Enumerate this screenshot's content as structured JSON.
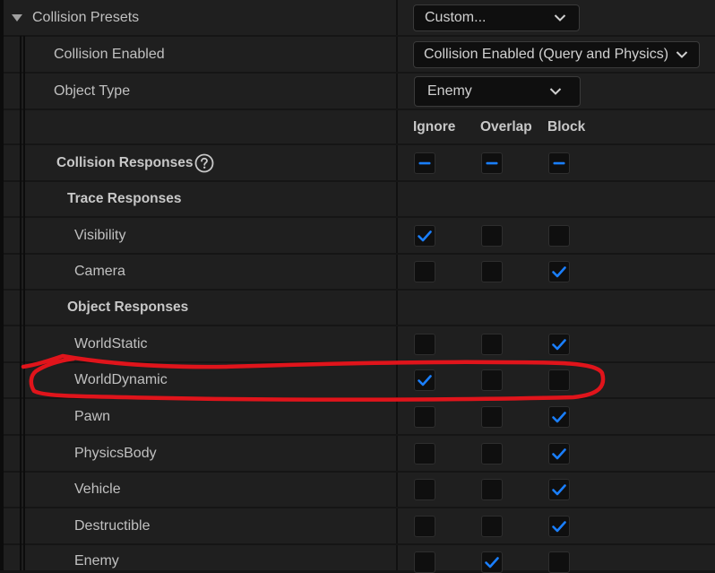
{
  "presets": {
    "label": "Collision Presets",
    "value": "Custom..."
  },
  "collision_enabled": {
    "label": "Collision Enabled",
    "value": "Collision Enabled (Query and Physics)"
  },
  "object_type": {
    "label": "Object Type",
    "value": "Enemy"
  },
  "columns": [
    "Ignore",
    "Overlap",
    "Block"
  ],
  "collision_responses": {
    "label": "Collision Responses",
    "state": [
      "mixed",
      "mixed",
      "mixed"
    ]
  },
  "trace_responses": {
    "label": "Trace Responses",
    "rows": [
      {
        "name": "Visibility",
        "state": [
          "checked",
          "unchecked",
          "unchecked"
        ]
      },
      {
        "name": "Camera",
        "state": [
          "unchecked",
          "unchecked",
          "checked"
        ]
      }
    ]
  },
  "object_responses": {
    "label": "Object Responses",
    "rows": [
      {
        "name": "WorldStatic",
        "state": [
          "unchecked",
          "unchecked",
          "checked"
        ]
      },
      {
        "name": "WorldDynamic",
        "state": [
          "checked",
          "unchecked",
          "unchecked"
        ]
      },
      {
        "name": "Pawn",
        "state": [
          "unchecked",
          "unchecked",
          "checked"
        ]
      },
      {
        "name": "PhysicsBody",
        "state": [
          "unchecked",
          "unchecked",
          "checked"
        ]
      },
      {
        "name": "Vehicle",
        "state": [
          "unchecked",
          "unchecked",
          "checked"
        ]
      },
      {
        "name": "Destructible",
        "state": [
          "unchecked",
          "unchecked",
          "checked"
        ]
      },
      {
        "name": "Enemy",
        "state": [
          "unchecked",
          "checked",
          "unchecked"
        ]
      }
    ]
  },
  "icons": {
    "expand": "triangle-down-icon",
    "dropdown": "chevron-down-icon",
    "help": "question-circle-icon",
    "check": "checkmark-icon",
    "mixed": "dash-icon"
  },
  "colors": {
    "accent": "#1a7fff",
    "annotation": "#e0141b",
    "panel": "#1f1f1f",
    "background": "#151515"
  }
}
